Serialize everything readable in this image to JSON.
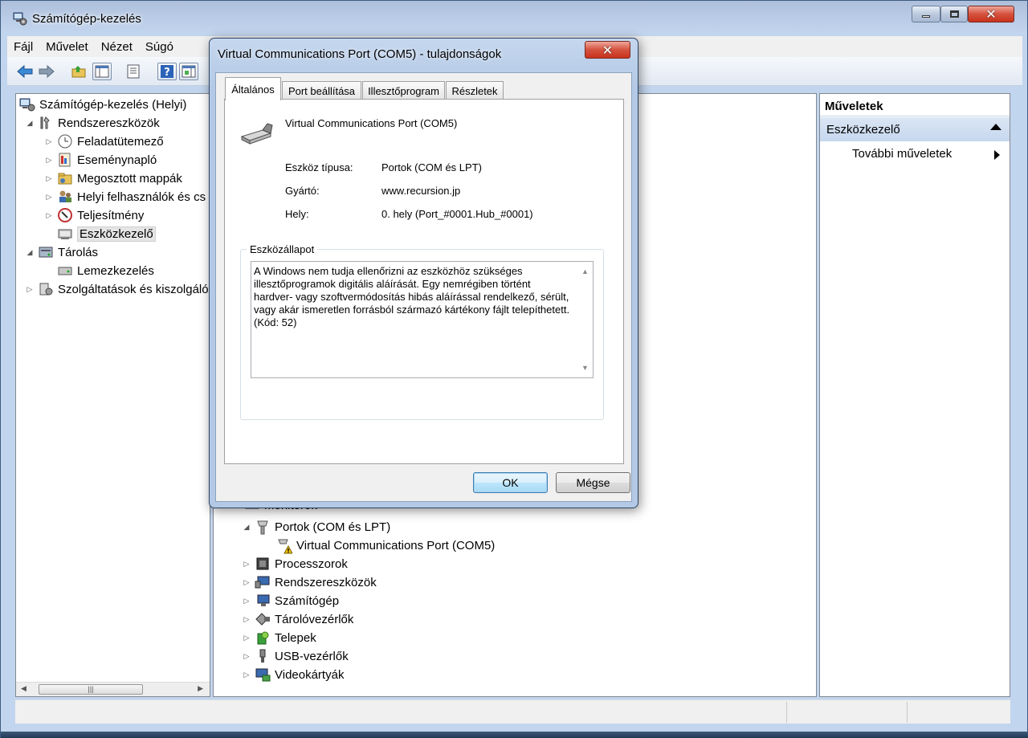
{
  "window": {
    "title": "Számítógép-kezelés"
  },
  "menu": [
    "Fájl",
    "Művelet",
    "Nézet",
    "Súgó"
  ],
  "tree": {
    "root": "Számítógép-kezelés (Helyi)",
    "system_tools": "Rendszereszközök",
    "task_scheduler": "Feladatütemező",
    "event_viewer": "Eseménynapló",
    "shared_folders": "Megosztott mappák",
    "local_users": "Helyi felhasználók és cs",
    "performance": "Teljesítmény",
    "device_manager": "Eszközkezelő",
    "storage": "Tárolás",
    "disk_management": "Lemezkezelés",
    "services": "Szolgáltatások és kiszolgáló"
  },
  "devices": {
    "partial_monitors": "Monitorok",
    "ports": "Portok (COM és LPT)",
    "port_child": "Virtual Communications Port (COM5)",
    "processors": "Processzorok",
    "system_devices": "Rendszereszközök",
    "computer": "Számítógép",
    "storage_controllers": "Tárolóvezérlők",
    "batteries": "Telepek",
    "usb": "USB-vezérlők",
    "video": "Videokártyák"
  },
  "actions": {
    "title": "Műveletek",
    "section": "Eszközkezelő",
    "more": "További műveletek"
  },
  "dialog": {
    "title": "Virtual Communications Port (COM5) - tulajdonságok",
    "tabs": [
      "Általános",
      "Port beállítása",
      "Illesztőprogram",
      "Részletek"
    ],
    "device_name": "Virtual Communications Port (COM5)",
    "type_label": "Eszköz típusa:",
    "type_value": "Portok (COM és LPT)",
    "manufacturer_label": "Gyártó:",
    "manufacturer_value": "www.recursion.jp",
    "location_label": "Hely:",
    "location_value": "0. hely (Port_#0001.Hub_#0001)",
    "status_group": "Eszközállapot",
    "status_text": "A Windows nem tudja ellenőrizni az eszközhöz szükséges illesztőprogramok digitális aláírását. Egy nemrégiben történt hardver- vagy szoftvermódosítás hibás aláírással rendelkező, sérült, vagy akár ismeretlen forrásból származó kártékony fájlt telepíthetett. (Kód: 52)",
    "ok": "OK",
    "cancel": "Mégse"
  }
}
